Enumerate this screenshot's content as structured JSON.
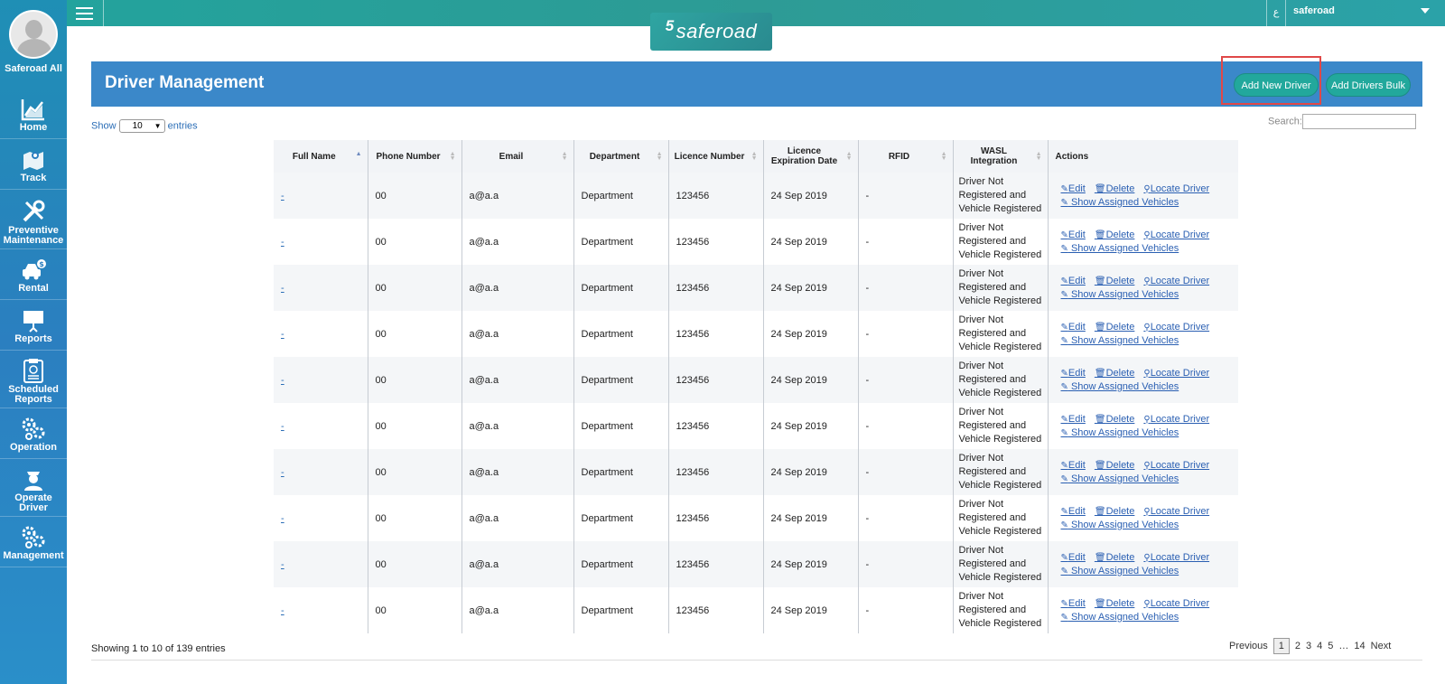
{
  "user": {
    "name": "Saferoad All"
  },
  "nav": [
    {
      "label": "Home",
      "icon": "chart-icon"
    },
    {
      "label": "Track",
      "icon": "map-icon"
    },
    {
      "label": "Preventive Maintenance",
      "icon": "tools-icon"
    },
    {
      "label": "Rental",
      "icon": "car-dollar-icon"
    },
    {
      "label": "Reports",
      "icon": "presentation-icon"
    },
    {
      "label": "Scheduled Reports",
      "icon": "clipboard-icon"
    },
    {
      "label": "Operation",
      "icon": "gears-icon"
    },
    {
      "label": "Operate Driver",
      "icon": "driver-icon"
    },
    {
      "label": "Management",
      "icon": "gears-icon"
    }
  ],
  "topbar": {
    "lang": "ع",
    "account": "saferoad"
  },
  "logo": {
    "mark": "5",
    "text": "saferoad"
  },
  "panel": {
    "title": "Driver Management",
    "add_driver": "Add New Driver",
    "add_bulk": "Add Drivers Bulk"
  },
  "controls": {
    "show": "Show",
    "entries_value": "10",
    "entries": "entries",
    "search_label": "Search:"
  },
  "table": {
    "columns": [
      "Full Name",
      "Phone Number",
      "Email",
      "Department",
      "Licence Number",
      "Licence Expiration Date",
      "RFID",
      "WASL Integration",
      "Actions"
    ],
    "rows": [
      {
        "name": "-",
        "phone": "00",
        "email": "a@a.a",
        "dept": "Department",
        "licence": "123456",
        "expiry": "24 Sep 2019",
        "rfid": "-",
        "wasl": "Driver Not Registered and Vehicle Registered"
      },
      {
        "name": "-",
        "phone": "00",
        "email": "a@a.a",
        "dept": "Department",
        "licence": "123456",
        "expiry": "24 Sep 2019",
        "rfid": "-",
        "wasl": "Driver Not Registered and Vehicle Registered"
      },
      {
        "name": "-",
        "phone": "00",
        "email": "a@a.a",
        "dept": "Department",
        "licence": "123456",
        "expiry": "24 Sep 2019",
        "rfid": "-",
        "wasl": "Driver Not Registered and Vehicle Registered"
      },
      {
        "name": "-",
        "phone": "00",
        "email": "a@a.a",
        "dept": "Department",
        "licence": "123456",
        "expiry": "24 Sep 2019",
        "rfid": "-",
        "wasl": "Driver Not Registered and Vehicle Registered"
      },
      {
        "name": "-",
        "phone": "00",
        "email": "a@a.a",
        "dept": "Department",
        "licence": "123456",
        "expiry": "24 Sep 2019",
        "rfid": "-",
        "wasl": "Driver Not Registered and Vehicle Registered"
      },
      {
        "name": "-",
        "phone": "00",
        "email": "a@a.a",
        "dept": "Department",
        "licence": "123456",
        "expiry": "24 Sep 2019",
        "rfid": "-",
        "wasl": "Driver Not Registered and Vehicle Registered"
      },
      {
        "name": "-",
        "phone": "00",
        "email": "a@a.a",
        "dept": "Department",
        "licence": "123456",
        "expiry": "24 Sep 2019",
        "rfid": "-",
        "wasl": "Driver Not Registered and Vehicle Registered"
      },
      {
        "name": "-",
        "phone": "00",
        "email": "a@a.a",
        "dept": "Department",
        "licence": "123456",
        "expiry": "24 Sep 2019",
        "rfid": "-",
        "wasl": "Driver Not Registered and Vehicle Registered"
      },
      {
        "name": "-",
        "phone": "00",
        "email": "a@a.a",
        "dept": "Department",
        "licence": "123456",
        "expiry": "24 Sep 2019",
        "rfid": "-",
        "wasl": "Driver Not Registered and Vehicle Registered"
      },
      {
        "name": "-",
        "phone": "00",
        "email": "a@a.a",
        "dept": "Department",
        "licence": "123456",
        "expiry": "24 Sep 2019",
        "rfid": "-",
        "wasl": "Driver Not Registered and Vehicle Registered"
      }
    ],
    "actions": {
      "edit": "Edit",
      "delete": "Delete",
      "locate": "Locate Driver",
      "vehicles": " Show Assigned Vehicles"
    }
  },
  "footer": {
    "info": "Showing 1 to 10 of 139 entries",
    "pager": {
      "prev": "Previous",
      "pages": [
        "1",
        "2",
        "3",
        "4",
        "5",
        "…",
        "14"
      ],
      "next": "Next"
    }
  },
  "colors": {
    "sidebar": "#2b7fc0",
    "topbar": "#2d9b95",
    "panel": "#3b88c9",
    "button": "#22a89c",
    "link": "#2a5fb2"
  }
}
